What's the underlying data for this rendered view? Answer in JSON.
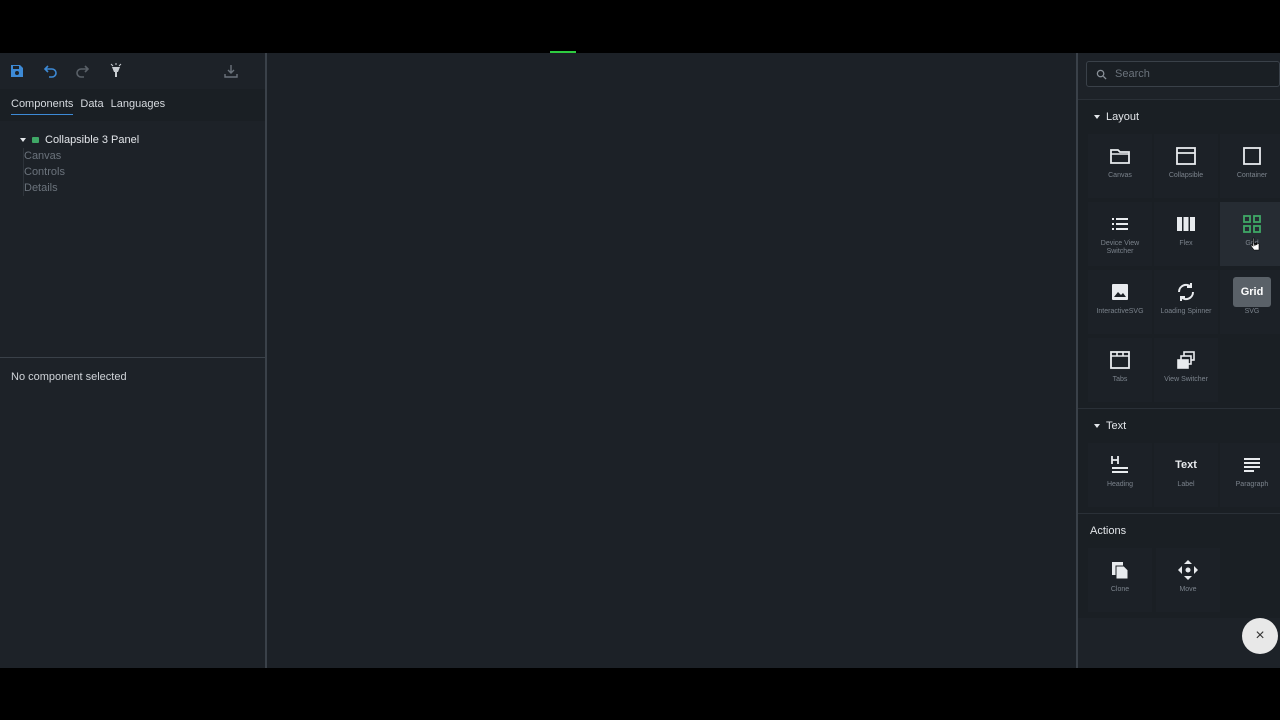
{
  "toolbar": {
    "icons": [
      "save-icon",
      "undo-icon",
      "redo-icon",
      "lamp-icon",
      "download-icon"
    ]
  },
  "left_tabs": [
    {
      "label": "Components",
      "active": true
    },
    {
      "label": "Data",
      "active": false
    },
    {
      "label": "Languages",
      "active": false
    }
  ],
  "tree": {
    "root": "Collapsible 3 Panel",
    "children": [
      "Canvas",
      "Controls",
      "Details"
    ]
  },
  "inspector": {
    "empty_text": "No component selected"
  },
  "palette": {
    "search_placeholder": "Search",
    "layout": {
      "title": "Layout",
      "items": [
        {
          "label": "Canvas",
          "icon": "folder-icon"
        },
        {
          "label": "Collapsible",
          "icon": "collapsible-icon"
        },
        {
          "label": "Container",
          "icon": "square-icon"
        },
        {
          "label": "Device View Switcher",
          "icon": "list-icon"
        },
        {
          "label": "Flex",
          "icon": "columns-icon"
        },
        {
          "label": "Grid",
          "icon": "grid-icon"
        },
        {
          "label": "InteractiveSVG",
          "icon": "image-icon"
        },
        {
          "label": "Loading Spinner",
          "icon": "refresh-icon"
        },
        {
          "label": "SVG",
          "icon": "grid-badge-icon",
          "badge": "Grid"
        },
        {
          "label": "Tabs",
          "icon": "tabs-icon"
        },
        {
          "label": "View Switcher",
          "icon": "view-switcher-icon"
        }
      ]
    },
    "text": {
      "title": "Text",
      "items": [
        {
          "label": "Heading",
          "icon": "heading-icon"
        },
        {
          "label": "Label",
          "icon": "label-text-icon",
          "glyph": "Text"
        },
        {
          "label": "Paragraph",
          "icon": "paragraph-icon"
        }
      ]
    },
    "actions": {
      "title": "Actions",
      "items": [
        {
          "label": "Clone",
          "icon": "clone-icon"
        },
        {
          "label": "Move",
          "icon": "move-icon"
        }
      ]
    }
  },
  "fab": {
    "glyph": "×"
  },
  "colors": {
    "accent": "#3d8ad6",
    "green": "#3fa866",
    "bg": "#1c2127"
  }
}
